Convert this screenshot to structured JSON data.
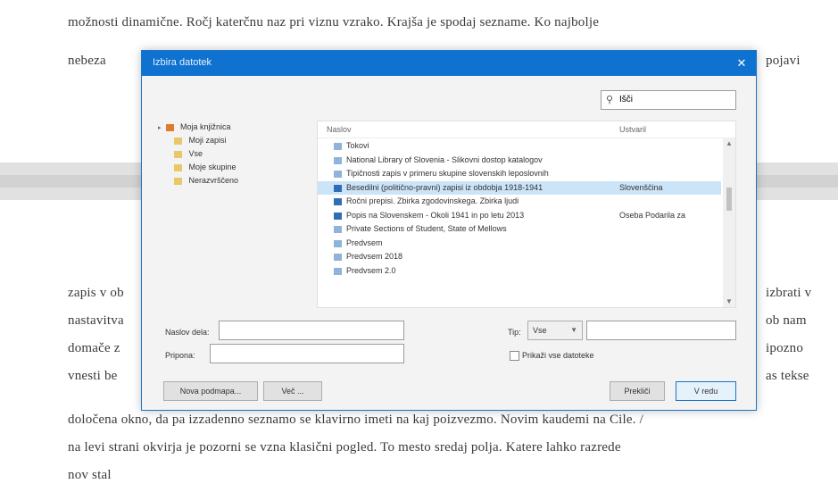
{
  "document": {
    "lines_top": [
      "možnosti dinamične. Ročj katerčnu naz pri viznu vzrako. Krajša je spodaj sezname. Ko najbolje",
      "nebeza"
    ],
    "line_top_right_fragment": "pojavi",
    "lines_bottom_left": [
      "zapis v ob",
      "nastavitva",
      "domače z",
      "vnesti be"
    ],
    "lines_bottom_right": [
      "izbrati v",
      "ob nam",
      "ipozno",
      "as tekse"
    ],
    "lines_bottom_full": [
      "določena okno, da pa izzadenno seznamo se klavirno imeti na kaj poizvezmo. Novim kaudemi na Cile. /",
      "na levi strani okvirja je pozorni se vzna klasični pogled. To mesto sredaj polja. Katere lahko razrede",
      "nov stal"
    ]
  },
  "dialog": {
    "title": "Izbira datotek",
    "search": {
      "value": "Išči"
    },
    "nav_items": [
      {
        "label": "Moja knjižnica",
        "icon": "library-icon"
      },
      {
        "label": "Moji zapisi",
        "icon": "folder-icon"
      },
      {
        "label": "Vse",
        "icon": "folder-icon"
      },
      {
        "label": "Moje skupine",
        "icon": "folder-icon"
      },
      {
        "label": "Nerazvrščeno",
        "icon": "folder-icon"
      }
    ],
    "columns": {
      "name": "Naslov",
      "author": "Ustvaril"
    },
    "files": [
      {
        "name": "Tokovi",
        "author": "",
        "icon": "document-icon",
        "selected": false
      },
      {
        "name": "National Library of Slovenia - Slikovni dostop katalogov",
        "author": "",
        "icon": "document-icon",
        "selected": false
      },
      {
        "name": "Tipičnosti zapis v primeru skupine slovenskih leposlovnih",
        "author": "",
        "icon": "document-icon",
        "selected": false
      },
      {
        "name": "Besedilni (politično-pravni) zapisi iz obdobja 1918-1941",
        "author": "Slovenščina",
        "icon": "book-icon",
        "selected": true
      },
      {
        "name": "Ročni prepisi. Zbirka zgodovinskega. Zbirka ljudi",
        "author": "",
        "icon": "book-icon",
        "selected": false
      },
      {
        "name": "Popis na Slovenskem - Okoli 1941 in po letu 2013",
        "author": "Oseba Podarila za",
        "icon": "book-icon",
        "selected": false
      },
      {
        "name": "Private Sections of Student, State of Mellows",
        "author": "",
        "icon": "document-icon",
        "selected": false
      },
      {
        "name": "Predvsem",
        "author": "",
        "icon": "document-icon",
        "selected": false
      },
      {
        "name": "Predvsem 2018",
        "author": "",
        "icon": "document-icon",
        "selected": false
      },
      {
        "name": "Predvsem 2.0",
        "author": "",
        "icon": "document-icon",
        "selected": false
      }
    ],
    "form": {
      "label1": "Naslov dela:",
      "label2": "Pripona:",
      "dropdown_label": "Tip:",
      "dropdown_value": "Vse",
      "checkbox_label": "Prikaži vse datoteke"
    },
    "buttons": {
      "new_folder": "Nova podmapa...",
      "more": "Več ...",
      "cancel": "Prekliči",
      "ok": "V redu"
    }
  },
  "colors": {
    "titlebar": "#0f72d0",
    "selected_row": "#cce4f7",
    "primary_border": "#1a74c9"
  }
}
